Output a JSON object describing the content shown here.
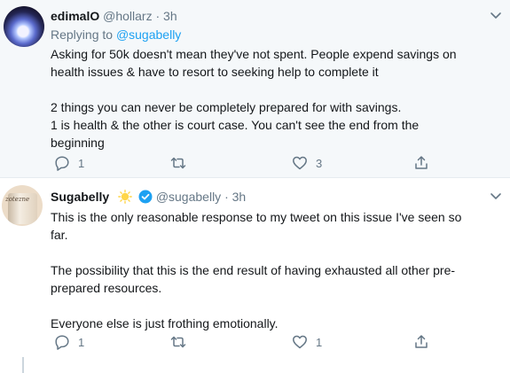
{
  "tweets": [
    {
      "name": "edimalO",
      "handle": "@hollarz",
      "separator": "·",
      "time": "3h",
      "replying_prefix": "Replying to",
      "replying_to": "@sugabelly",
      "lines": [
        "Asking for 50k doesn't mean they've not spent. People expend savings on",
        "health issues & have to resort to seeking help to complete it",
        "",
        "2 things you can never be completely prepared for with savings.",
        "1 is health & the other is court case. You can't see the end from the",
        "beginning"
      ],
      "replies": "1",
      "retweets": "",
      "likes": "3",
      "avatar_icon": "profile-photo"
    },
    {
      "name": "Sugabelly",
      "handle": "@sugabelly",
      "separator": "·",
      "time": "3h",
      "lines": [
        "This is the only reasonable response to my tweet on this issue I've seen so",
        "far.",
        "",
        "The possibility that this is the end result of having exhausted all other pre-",
        "prepared resources.",
        "",
        "Everyone else is just frothing emotionally."
      ],
      "replies": "1",
      "retweets": "",
      "likes": "1",
      "avatar_text": "zotezne",
      "badges": [
        "sun-emoji-icon",
        "verified-badge-icon"
      ]
    }
  ],
  "colors": {
    "accent": "#1da1f2",
    "secondary_text": "#657786",
    "highlight_bg": "#f5f8fa"
  }
}
